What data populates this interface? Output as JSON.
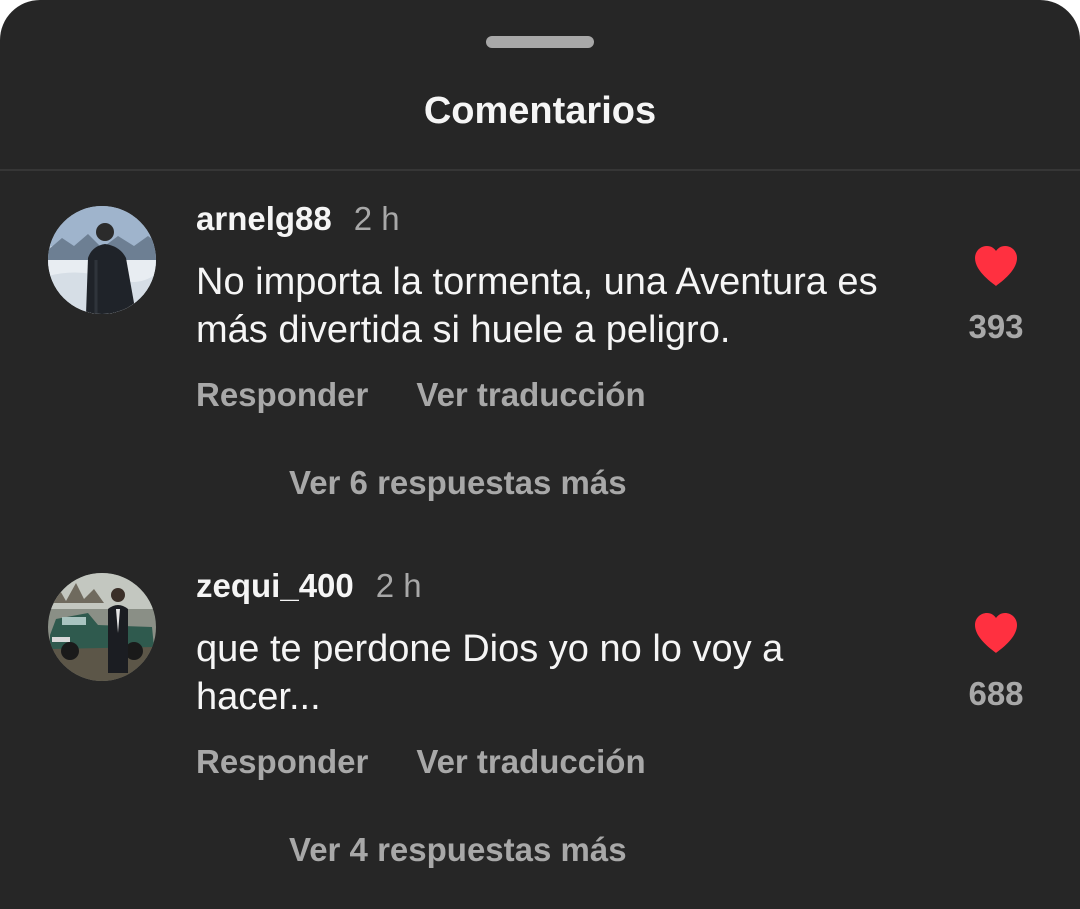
{
  "sheet": {
    "title": "Comentarios"
  },
  "colors": {
    "background": "#262626",
    "primary_text": "#f5f5f5",
    "secondary_text": "#a8a8a8",
    "like_red": "#ff3040"
  },
  "comments": [
    {
      "username": "arnelg88",
      "time": "2 h",
      "text": "No importa la tormenta, una Aventura es más divertida si huele a peligro.",
      "reply_label": "Responder",
      "translate_label": "Ver traducción",
      "like_count": "393",
      "liked": true,
      "more_replies": "Ver 6 respuestas más",
      "avatar_icon": "user-avatar-snow"
    },
    {
      "username": "zequi_400",
      "time": "2 h",
      "text": "que te perdone Dios yo no lo voy a hacer...",
      "reply_label": "Responder",
      "translate_label": "Ver traducción",
      "like_count": "688",
      "liked": true,
      "more_replies": "Ver 4 respuestas más",
      "avatar_icon": "user-avatar-car"
    }
  ]
}
